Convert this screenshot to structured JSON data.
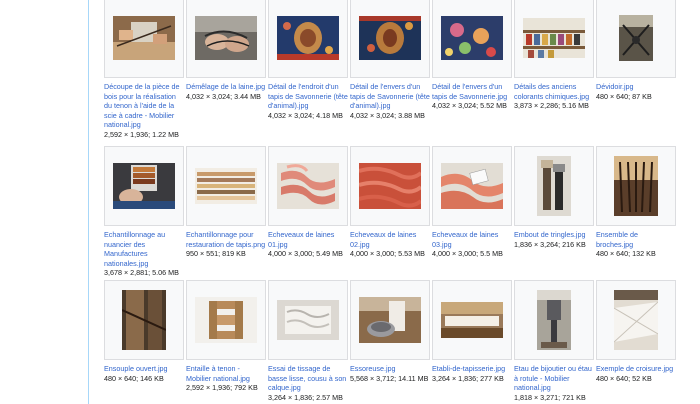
{
  "gallery": {
    "items": [
      {
        "name": "Découpe de la pièce de bois pour la réalisation du tenon à l'aide de la scie à cadre - Mobilier national.jpg",
        "meta": "2,592 × 1,936; 1.22 MB",
        "icon": "photo-carpentry-saw"
      },
      {
        "name": "Démêlage de la laine.jpg",
        "meta": "4,032 × 3,024; 3.44 MB",
        "icon": "photo-wool-untangling"
      },
      {
        "name": "Détail de l'endroit d'un tapis de Savonnerie (tête d'animal).jpg",
        "meta": "4,032 × 3,024; 4.18 MB",
        "icon": "photo-carpet-front"
      },
      {
        "name": "Détail de l'envers d'un tapis de Savonnerie (tête d'animal).jpg",
        "meta": "4,032 × 3,024; 3.88 MB",
        "icon": "photo-carpet-back"
      },
      {
        "name": "Détail de l'envers d'un tapis de Savonnerie.jpg",
        "meta": "4,032 × 3,024; 5.52 MB",
        "icon": "photo-carpet-floral"
      },
      {
        "name": "Détails des anciens colorants chimiques.jpg",
        "meta": "3,873 × 2,286; 5.16 MB",
        "icon": "photo-dye-jars"
      },
      {
        "name": "Dévidoir.jpg",
        "meta": "480 × 640; 87 KB",
        "icon": "photo-reel"
      },
      {
        "name": "Echantillonnage au nuancier des Manufactures nationales.jpg",
        "meta": "3,678 × 2,881; 5.06 MB",
        "icon": "photo-color-chart"
      },
      {
        "name": "Echantillonnage pour restauration de tapis.png",
        "meta": "950 × 551; 819 KB",
        "icon": "photo-yarn-samples"
      },
      {
        "name": "Echeveaux de laines 01.jpg",
        "meta": "4,000 × 3,000; 5.49 MB",
        "icon": "photo-skeins-pink"
      },
      {
        "name": "Echeveaux de laines 02.jpg",
        "meta": "4,000 × 3,000; 5.53 MB",
        "icon": "photo-skeins-red"
      },
      {
        "name": "Echeveaux de laines 03.jpg",
        "meta": "4,000 × 3,000; 5.5 MB",
        "icon": "photo-skeins-tag"
      },
      {
        "name": "Embout de tringles.jpg",
        "meta": "1,836 × 3,264; 216 KB",
        "icon": "photo-rod-ends"
      },
      {
        "name": "Ensemble de broches.jpg",
        "meta": "480 × 640; 132 KB",
        "icon": "photo-spindles"
      },
      {
        "name": "Ensouple ouvert.jpg",
        "meta": "480 × 640; 146 KB",
        "icon": "photo-beam"
      },
      {
        "name": "Entaille à tenon - Mobilier national.jpg",
        "meta": "2,592 × 1,936; 792 KB",
        "icon": "photo-tenon-joint"
      },
      {
        "name": "Essai de tissage de basse lisse, cousu à son calque.jpg",
        "meta": "3,264 × 1,836; 2.57 MB",
        "icon": "photo-weaving-test"
      },
      {
        "name": "Essoreuse.jpg",
        "meta": "5,568 × 3,712; 14.11 MB",
        "icon": "photo-spin-dryer"
      },
      {
        "name": "Etabli-de-tapisserie.jpg",
        "meta": "3,264 × 1,836; 277 KB",
        "icon": "photo-workbench"
      },
      {
        "name": "Etau de bijoutier ou étau à rotule - Mobilier national.jpg",
        "meta": "1,818 × 3,271; 721 KB",
        "icon": "photo-vise"
      },
      {
        "name": "Exemple de croisure.jpg",
        "meta": "480 × 640; 52 KB",
        "icon": "photo-cross-warp"
      }
    ]
  }
}
